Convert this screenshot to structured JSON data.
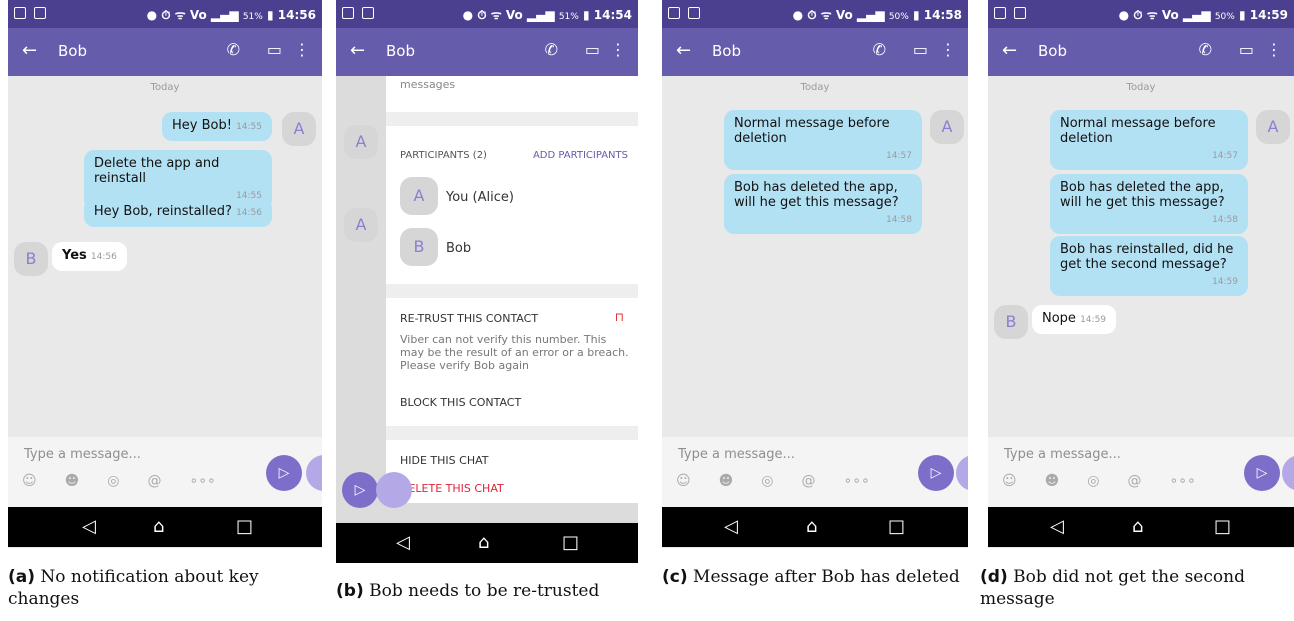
{
  "status": {
    "a": {
      "pct": "51%",
      "time": "14:56"
    },
    "b": {
      "pct": "51%",
      "time": "14:54"
    },
    "c": {
      "pct": "50%",
      "time": "14:58"
    },
    "d": {
      "pct": "50%",
      "time": "14:59"
    }
  },
  "header": {
    "contact": "Bob",
    "back_icon": "←",
    "call_icon": "✆",
    "video_icon": "▭",
    "menu_icon": "⋮"
  },
  "day_label": "Today",
  "composer": {
    "placeholder": "Type a message..."
  },
  "panel_a": {
    "messages": [
      {
        "text": "Hey Bob!",
        "time": "14:55"
      },
      {
        "text": "Delete the app and reinstall",
        "time": "14:55"
      },
      {
        "text": "Hey Bob, reinstalled?",
        "time": "14:56"
      },
      {
        "text": "Yes",
        "time": "14:56"
      }
    ],
    "caption_label": "(a)",
    "caption_text": "No notification about key changes"
  },
  "panel_b": {
    "partial_text": "messages",
    "participants_header": "PARTICIPANTS (2)",
    "add_participants": "ADD PARTICIPANTS",
    "participants": [
      "You (Alice)",
      "Bob"
    ],
    "participant_initials": [
      "A",
      "B"
    ],
    "retrust_title": "RE-TRUST THIS CONTACT",
    "retrust_desc": "Viber can not verify this number. This may be the result of an error or a breach. Please verify Bob again",
    "block": "BLOCK THIS CONTACT",
    "hide": "HIDE THIS CHAT",
    "delete": "DELETE THIS CHAT",
    "caption_label": "(b)",
    "caption_text": "Bob needs to be re-trusted"
  },
  "panel_c": {
    "messages": [
      {
        "text": "Normal message before deletion",
        "time": "14:57"
      },
      {
        "text": "Bob has deleted the app, will he get this message?",
        "time": "14:58"
      }
    ],
    "caption_label": "(c)",
    "caption_text": "Message after Bob has deleted"
  },
  "panel_d": {
    "messages": [
      {
        "text": "Normal message before deletion",
        "time": "14:57"
      },
      {
        "text": "Bob has deleted the app, will he get this message?",
        "time": "14:58"
      },
      {
        "text": "Bob has reinstalled, did he get the second message?",
        "time": "14:59"
      },
      {
        "text": "Nope",
        "time": "14:59"
      }
    ],
    "caption_label": "(d)",
    "caption_text": "Bob did not get the second message"
  },
  "avatars": {
    "alice": "A",
    "bob": "B"
  }
}
